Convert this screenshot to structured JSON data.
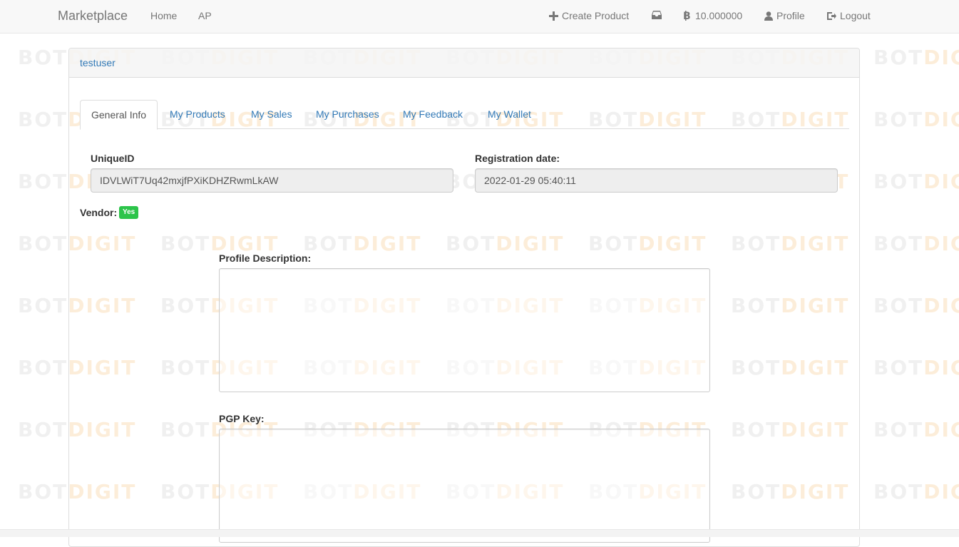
{
  "navbar": {
    "brand": "Marketplace",
    "home": "Home",
    "ap": "AP",
    "create_product": "Create Product",
    "balance": "10.000000",
    "profile": "Profile",
    "logout": "Logout"
  },
  "panel": {
    "username": "testuser"
  },
  "tabs": [
    {
      "label": "General Info"
    },
    {
      "label": "My Products"
    },
    {
      "label": "My Sales"
    },
    {
      "label": "My Purchases"
    },
    {
      "label": "My Feedback"
    },
    {
      "label": "My Wallet"
    }
  ],
  "general": {
    "unique_id_label": "UniqueID",
    "unique_id_value": "IDVLWiT7Uq42mxjfPXiKDHZRwmLkAW",
    "reg_date_label": "Registration date:",
    "reg_date_value": "2022-01-29 05:40:11",
    "vendor_label": "Vendor:",
    "vendor_value": "Yes",
    "profile_desc_label": "Profile Description:",
    "profile_desc_value": "",
    "pgp_key_label": "PGP Key:",
    "pgp_key_value": ""
  },
  "watermark": {
    "left": "BOT",
    "right": "DIGIT"
  },
  "colors": {
    "link": "#337ab7",
    "badge_green": "#2cc44a"
  }
}
